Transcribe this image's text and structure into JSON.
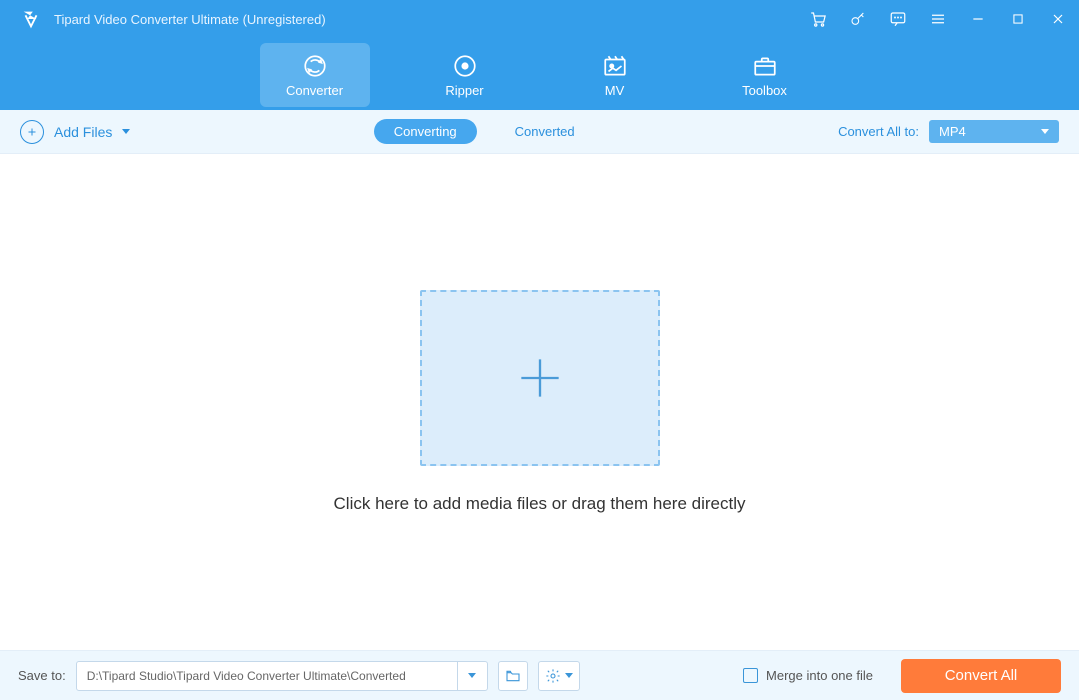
{
  "titlebar": {
    "title": "Tipard Video Converter Ultimate (Unregistered)"
  },
  "nav": {
    "items": [
      {
        "label": "Converter"
      },
      {
        "label": "Ripper"
      },
      {
        "label": "MV"
      },
      {
        "label": "Toolbox"
      }
    ]
  },
  "toolbar": {
    "add_files": "Add Files",
    "tab_converting": "Converting",
    "tab_converted": "Converted",
    "convert_all_to": "Convert All to:",
    "format": "MP4"
  },
  "main": {
    "hint": "Click here to add media files or drag them here directly"
  },
  "footer": {
    "save_to": "Save to:",
    "path": "D:\\Tipard Studio\\Tipard Video Converter Ultimate\\Converted",
    "merge": "Merge into one file",
    "convert": "Convert All"
  }
}
